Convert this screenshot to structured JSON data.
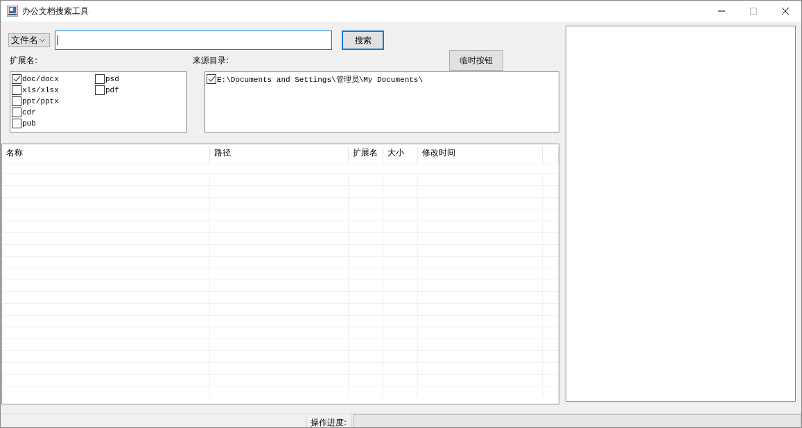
{
  "window": {
    "title": "办公文档搜索工具"
  },
  "search": {
    "mode": "文件名",
    "focused": true,
    "button": "搜索"
  },
  "temp_button": "临时按钮",
  "extensions": {
    "label": "扩展名:",
    "items": [
      {
        "label": "doc/docx",
        "checked": true
      },
      {
        "label": "xls/xlsx",
        "checked": false
      },
      {
        "label": "ppt/pptx",
        "checked": false
      },
      {
        "label": "cdr",
        "checked": false
      },
      {
        "label": "pub",
        "checked": false
      },
      {
        "label": "psd",
        "checked": false
      },
      {
        "label": "pdf",
        "checked": false
      }
    ]
  },
  "sources": {
    "label": "来源目录:",
    "items": [
      {
        "label": "E:\\Documents and Settings\\管理员\\My Documents\\",
        "checked": true
      }
    ]
  },
  "table": {
    "columns": [
      "名称",
      "路径",
      "扩展名",
      "大小",
      "修改时间"
    ]
  },
  "status_bar": {
    "progress_label": "操作进度:",
    "level": 0
  }
}
